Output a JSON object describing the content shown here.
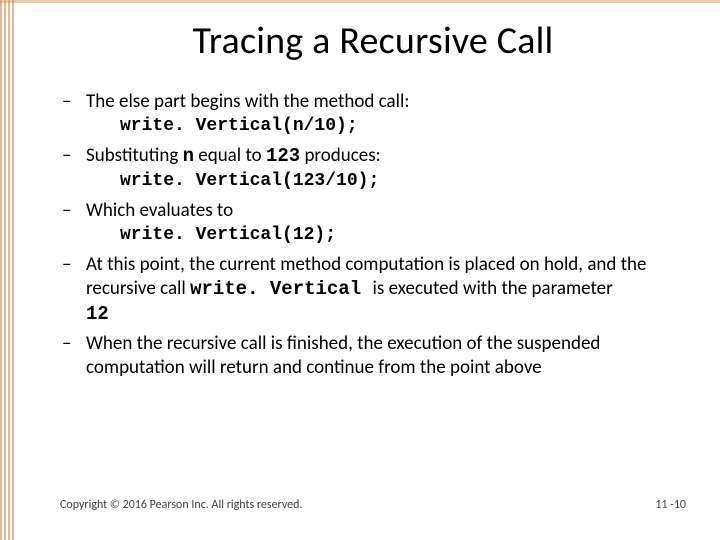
{
  "title": "Tracing a Recursive Call",
  "bullets": {
    "b1": {
      "text": "The else part begins with the method call:",
      "code": "write. Vertical(n/10);"
    },
    "b2": {
      "pre": "Substituting ",
      "n": "n",
      "mid": " equal to ",
      "num": "123",
      "post": " produces:",
      "code": "write. Vertical(123/10);"
    },
    "b3": {
      "text": "Which evaluates to",
      "code": "write. Vertical(12);"
    },
    "b4": {
      "pre": "At this point, the current method computation is placed on hold, and the recursive call ",
      "call": "write. Vertical ",
      "mid": " is executed with the parameter ",
      "param": "12"
    },
    "b5": {
      "text": "When the recursive call is finished, the execution of the suspended computation will return and continue from the point above"
    }
  },
  "footer": {
    "copyright": "Copyright © 2016 Pearson Inc. All rights reserved.",
    "pagenum": "11 -10"
  }
}
